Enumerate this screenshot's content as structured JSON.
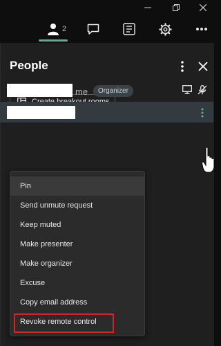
{
  "toolbar": {
    "people_count": "2",
    "icons": [
      "people-icon",
      "chat-icon",
      "whiteboard-icon",
      "settings-icon",
      "more-icon"
    ]
  },
  "panel": {
    "title": "People",
    "breakout_label": "Create breakout rooms"
  },
  "participants": [
    {
      "name_redacted": true,
      "me_label": "me",
      "role": "Organizer"
    },
    {
      "name_redacted": true
    }
  ],
  "menu": {
    "items": [
      "Pin",
      "Send unmute request",
      "Keep muted",
      "Make presenter",
      "Make organizer",
      "Excuse",
      "Copy email address",
      "Revoke remote control"
    ],
    "highlighted_index": 7,
    "hover_index": 0
  },
  "colors": {
    "accent": "#5fb09a",
    "highlight_box": "#e02020",
    "panel_bg": "#1f1f1f",
    "selected_row": "#333a40"
  }
}
